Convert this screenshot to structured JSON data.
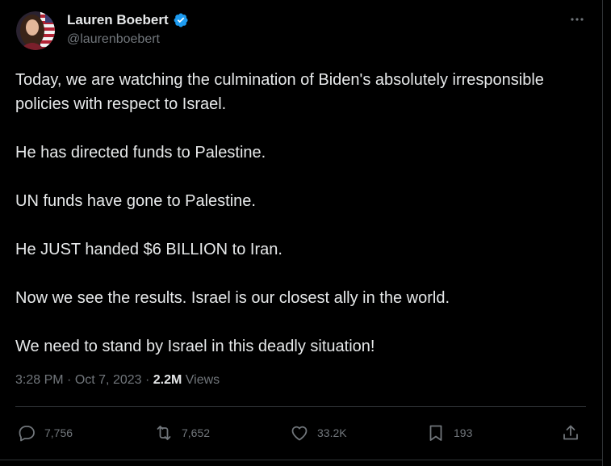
{
  "author": {
    "display_name": "Lauren Boebert",
    "handle": "@laurenboebert",
    "verified": true
  },
  "tweet": {
    "paragraphs": [
      "Today, we are watching the culmination of Biden's absolutely irresponsible policies with respect to Israel.",
      "He has directed funds to Palestine.",
      "UN funds have gone to Palestine.",
      "He JUST handed $6 BILLION to Iran.",
      "Now we see the results. Israel is our closest ally in the world.",
      "We need to stand by Israel in this deadly situation!"
    ],
    "time": "3:28 PM",
    "separator": " · ",
    "date": "Oct 7, 2023",
    "views_count": "2.2M",
    "views_label": " Views"
  },
  "actions": {
    "replies": "7,756",
    "reposts": "7,652",
    "likes": "33.2K",
    "bookmarks": "193"
  },
  "icons": {
    "more": "more-horizontal-icon",
    "reply": "speech-bubble-icon",
    "repost": "repost-arrows-icon",
    "like": "heart-icon",
    "bookmark": "bookmark-icon",
    "share": "share-upload-icon",
    "verified": "verified-badge-icon"
  },
  "colors": {
    "background": "#000000",
    "text_primary": "#e7e9ea",
    "text_secondary": "#71767b",
    "verified_blue": "#1d9bf0",
    "divider": "#2f3336"
  }
}
